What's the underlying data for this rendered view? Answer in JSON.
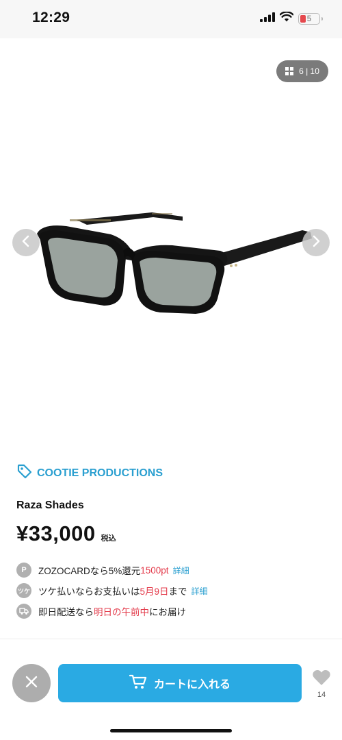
{
  "status_bar": {
    "time": "12:29",
    "battery_level": "5",
    "battery_color": "#e5484d",
    "icons": [
      "signal-icon",
      "wifi-icon",
      "battery-icon"
    ]
  },
  "gallery": {
    "current": 6,
    "total": 10,
    "counter_text": "6 | 10",
    "icons": [
      "grid-icon",
      "chevron-left-icon",
      "chevron-right-icon"
    ],
    "image": "sunglasses-product-image"
  },
  "product": {
    "brand": "COOTIE PRODUCTIONS",
    "name": "Raza Shades",
    "price": "¥33,000",
    "tax_label": "税込",
    "accent_color": "#2a9fd0"
  },
  "perks": [
    {
      "icon": "p-badge-icon",
      "badge": "P",
      "text_before": "ZOZOCARDなら5%還元 ",
      "highlight": "1500pt",
      "text_after": "",
      "link": "詳細"
    },
    {
      "icon": "tsuke-badge-icon",
      "badge": "ツケ",
      "text_before": "ツケ払いならお支払いは",
      "highlight": "5月9日",
      "text_after": "まで",
      "link": "詳細"
    },
    {
      "icon": "truck-badge-icon",
      "badge": "",
      "text_before": "即日配送なら",
      "highlight": "明日の午前中",
      "text_after": "にお届け",
      "link": ""
    }
  ],
  "actions": {
    "close_icon": "close-icon",
    "add_to_cart": "カートに入れる",
    "cart_icon": "cart-icon",
    "favorite_icon": "heart-icon",
    "favorite_count": "14",
    "button_color": "#2aaae3"
  }
}
